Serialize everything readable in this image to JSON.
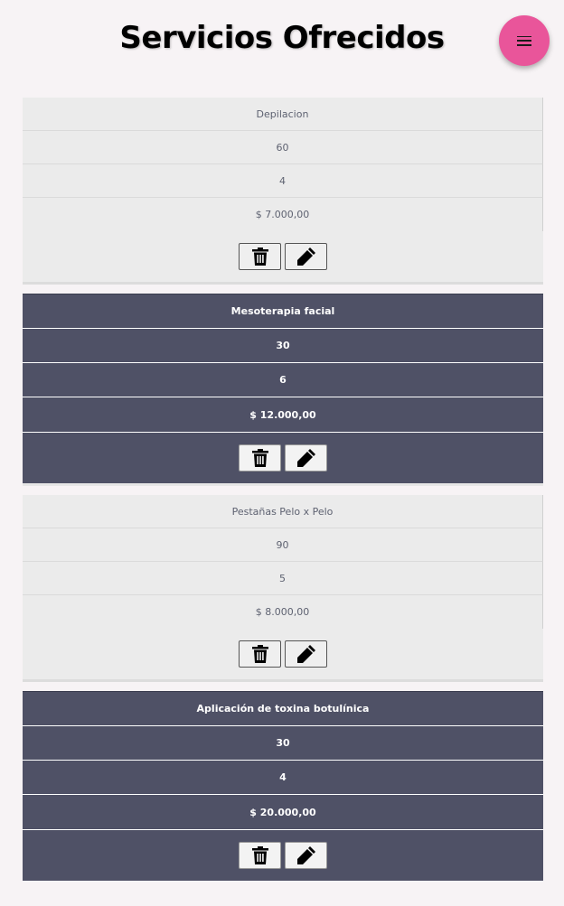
{
  "header": {
    "title": "Servicios Ofrecidos",
    "menu_icon": "hamburger-menu-icon",
    "menu_color": "#e9559a"
  },
  "services": [
    {
      "name": "Depilacion",
      "duration": "60",
      "sessions": "4",
      "price": "$ 7.000,00",
      "theme": "light"
    },
    {
      "name": "Mesoterapia facial",
      "duration": "30",
      "sessions": "6",
      "price": "$ 12.000,00",
      "theme": "dark"
    },
    {
      "name": "Pestañas Pelo x Pelo",
      "duration": "90",
      "sessions": "5",
      "price": "$ 8.000,00",
      "theme": "light"
    },
    {
      "name": "Aplicación de toxina botulínica",
      "duration": "30",
      "sessions": "4",
      "price": "$ 20.000,00",
      "theme": "dark"
    }
  ],
  "icons": {
    "delete": "trash-icon",
    "edit": "pencil-icon"
  },
  "colors": {
    "light_card": "#ebebeb",
    "dark_card": "#4f5166",
    "accent": "#e9559a"
  }
}
